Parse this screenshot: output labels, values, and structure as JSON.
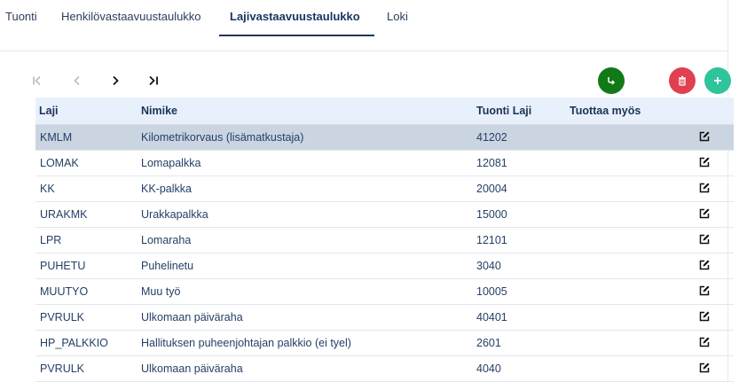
{
  "tabs": [
    {
      "label": "Tuonti"
    },
    {
      "label": "Henkilövastaavuustaulukko"
    },
    {
      "label": "Lajivastaavuustaulukko"
    },
    {
      "label": "Loki"
    }
  ],
  "pager": [
    "first-page-icon",
    "prev-page-icon",
    "next-page-icon",
    "last-page-icon"
  ],
  "actions": {
    "import_icon": "import-arrow-icon",
    "delete_icon": "trash-icon",
    "add_icon": "plus-icon",
    "colors": {
      "import": "#117a16",
      "delete": "#e0404f",
      "add": "#2ec49c"
    }
  },
  "table": {
    "headers": {
      "laji": "Laji",
      "nimike": "Nimike",
      "tuonti_laji": "Tuonti Laji",
      "tuottaa_myos": "Tuottaa myös"
    },
    "rows": [
      {
        "laji": "KMLM",
        "nimike": "Kilometrikorvaus (lisämatkustaja)",
        "tuonti_laji": "41202",
        "tuottaa_myos": ""
      },
      {
        "laji": "LOMAK",
        "nimike": "Lomapalkka",
        "tuonti_laji": "12081",
        "tuottaa_myos": ""
      },
      {
        "laji": "KK",
        "nimike": "KK-palkka",
        "tuonti_laji": "20004",
        "tuottaa_myos": ""
      },
      {
        "laji": "URAKMK",
        "nimike": "Urakkapalkka",
        "tuonti_laji": "15000",
        "tuottaa_myos": ""
      },
      {
        "laji": "LPR",
        "nimike": "Lomaraha",
        "tuonti_laji": "12101",
        "tuottaa_myos": ""
      },
      {
        "laji": "PUHETU",
        "nimike": "Puhelinetu",
        "tuonti_laji": "3040",
        "tuottaa_myos": ""
      },
      {
        "laji": "MUUTYO",
        "nimike": "Muu työ",
        "tuonti_laji": "10005",
        "tuottaa_myos": ""
      },
      {
        "laji": "PVRULK",
        "nimike": "Ulkomaan päiväraha",
        "tuonti_laji": "40401",
        "tuottaa_myos": ""
      },
      {
        "laji": "HP_PALKKIO",
        "nimike": "Hallituksen puheenjohtajan palkkio (ei tyel)",
        "tuonti_laji": "2601",
        "tuottaa_myos": ""
      },
      {
        "laji": "PVRULK",
        "nimike": "Ulkomaan päiväraha",
        "tuonti_laji": "4040",
        "tuottaa_myos": ""
      }
    ],
    "row_edit_icon": "edit-icon"
  }
}
